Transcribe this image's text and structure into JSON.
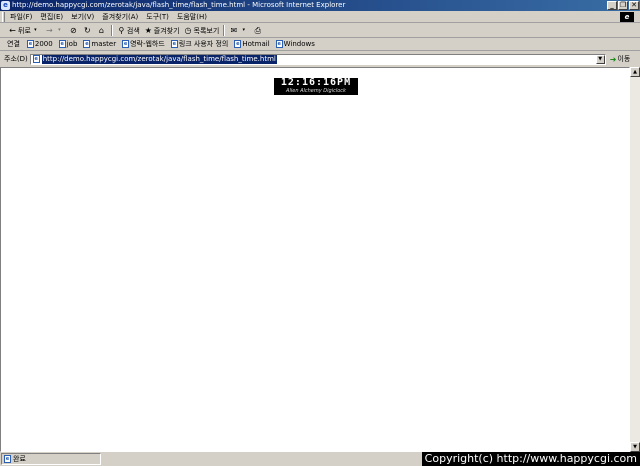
{
  "window": {
    "title": "http://demo.happycgi.com/zerotak/java/flash_time/flash_time.html - Microsoft Internet Explorer",
    "minimize_label": "_",
    "maximize_label": "❐",
    "close_label": "✕"
  },
  "menu": {
    "items": [
      "파일(F)",
      "편집(E)",
      "보기(V)",
      "즐겨찾기(A)",
      "도구(T)",
      "도움말(H)"
    ]
  },
  "toolbar": {
    "back": "뒤로",
    "search": "검색",
    "favorites": "즐겨찾기",
    "history": "목록보기"
  },
  "links": {
    "label": "연결",
    "items": [
      "2000",
      "job",
      "master",
      "영락-웹하드",
      "링크 사용자 정의",
      "Hotmail",
      "Windows"
    ]
  },
  "address": {
    "label": "주소(D)",
    "url": "http://demo.happycgi.com/zerotak/java/flash_time/flash_time.html",
    "go_label": "이동"
  },
  "clock": {
    "time": "12:16:16PM",
    "subtitle": "Alien Alchemy Digiclock"
  },
  "status": {
    "text": "완료",
    "copyright": "Copyright(c) http://www.happycgi.com"
  },
  "colors": {
    "titlebar": "#0a246a",
    "chrome": "#d4d0c8",
    "selection": "#0a246a"
  }
}
